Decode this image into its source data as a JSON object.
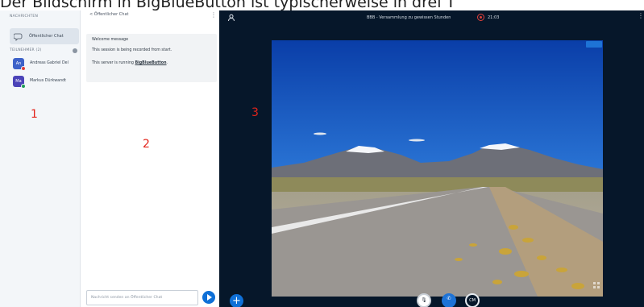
{
  "caption": "Der Bildschirm in BigBlueButton ist typischerweise in drei T",
  "sidebar": {
    "messages_label": "NACHRICHTEN",
    "public_chat_label": "Öffentlicher Chat",
    "users_label": "TEILNEHMER (2)",
    "users": [
      {
        "initials": "An",
        "name": "Andreas Gabriel Del",
        "avatar_color": "#3d62c9",
        "status_color": "#e0403a"
      },
      {
        "initials": "Ma",
        "name": "Markus Dürkwandt",
        "avatar_color": "#4b43b8",
        "status_color": "#1e9c56"
      }
    ]
  },
  "markers": {
    "one": "1",
    "two": "2",
    "three": "3"
  },
  "chat": {
    "header": "< Öffentlicher Chat",
    "menu": "⋮",
    "welcome_title": "Welcome message",
    "recorded_text": "This session is being recorded from start.",
    "server_prefix": "This server is running ",
    "server_link": "BigBlueButton",
    "server_suffix": ".",
    "input_placeholder": "Nachricht senden an Öffentlicher Chat"
  },
  "meeting": {
    "title": "BBB - Versammlung zu gewissen Stunden",
    "rec_time": "21:03",
    "menu": "⋮",
    "add_symbol": "+",
    "mic_symbol": "🎙",
    "phone_symbol": "✆",
    "cam_symbol": "CM"
  },
  "colors": {
    "accent": "#0f70d7",
    "dark_bg": "#06172a",
    "sidebar_bg": "#f3f6f9",
    "marker": "#e3241b"
  }
}
